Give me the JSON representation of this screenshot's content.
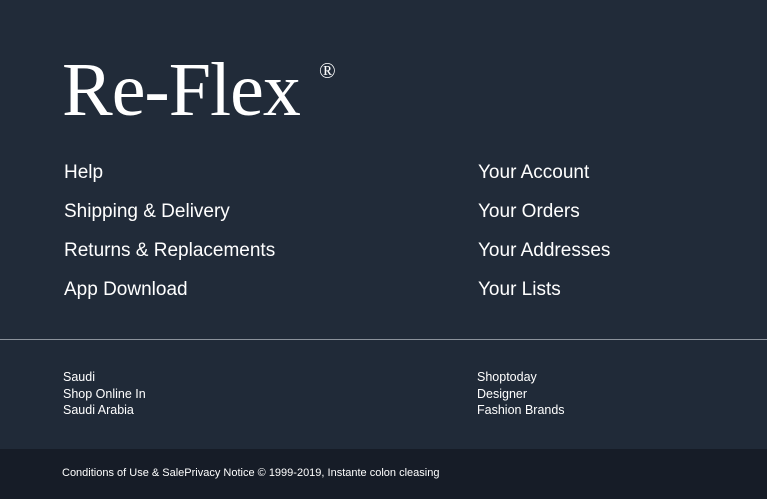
{
  "brand": {
    "name": "Re-Flex",
    "registered_mark": "®"
  },
  "links_left": [
    {
      "label": "Help"
    },
    {
      "label": "Shipping & Delivery"
    },
    {
      "label": "Returns & Replacements"
    },
    {
      "label": "App Download"
    }
  ],
  "links_right": [
    {
      "label": "Your Account"
    },
    {
      "label": "Your Orders"
    },
    {
      "label": "Your Addresses"
    },
    {
      "label": "Your Lists"
    }
  ],
  "sub_left": {
    "line1": "Saudi",
    "line2": "Shop Online In",
    "line3": "Saudi Arabia"
  },
  "sub_right": {
    "line1": "Shoptoday",
    "line2": "Designer",
    "line3": "Fashion Brands"
  },
  "legal": {
    "conditions": "Conditions of Use & Sale",
    "privacy": "Privacy Notice",
    "copyright": "© 1999-2019, Instante colon cleasing"
  },
  "colors": {
    "background": "#212b39",
    "bottom_bar": "#161c27",
    "divider": "#8c939c",
    "text": "#ffffff"
  }
}
